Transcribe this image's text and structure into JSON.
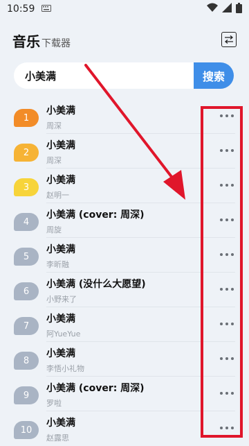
{
  "status": {
    "time": "10:59"
  },
  "header": {
    "title": "音乐",
    "subtitle": "下载器"
  },
  "search": {
    "value": "小美满",
    "button": "搜索"
  },
  "songs": [
    {
      "rank": "1",
      "title": "小美满",
      "artist": "周深",
      "badge_color": "#f28c28"
    },
    {
      "rank": "2",
      "title": "小美满",
      "artist": "周深",
      "badge_color": "#f6b335"
    },
    {
      "rank": "3",
      "title": "小美满",
      "artist": "赵明一",
      "badge_color": "#f7d43a"
    },
    {
      "rank": "4",
      "title": "小美满 (cover: 周深)",
      "artist": "周旋",
      "badge_color": "#a9b4c4"
    },
    {
      "rank": "5",
      "title": "小美满",
      "artist": "李昕融",
      "badge_color": "#a9b4c4"
    },
    {
      "rank": "6",
      "title": "小美满 (没什么大愿望)",
      "artist": "小野来了",
      "badge_color": "#a9b4c4"
    },
    {
      "rank": "7",
      "title": "小美满",
      "artist": "阿YueYue",
      "badge_color": "#a9b4c4"
    },
    {
      "rank": "8",
      "title": "小美满",
      "artist": "李悟小礼物",
      "badge_color": "#a9b4c4"
    },
    {
      "rank": "9",
      "title": "小美满 (cover: 周深)",
      "artist": "罗啦",
      "badge_color": "#a9b4c4"
    },
    {
      "rank": "10",
      "title": "小美满",
      "artist": "赵露思",
      "badge_color": "#a9b4c4"
    }
  ],
  "colors": {
    "accent": "#3f8ee8",
    "annotation": "#e0162b",
    "background": "#eef2f7"
  },
  "icons": {
    "sort": "sort-icon",
    "more": "more-icon",
    "wifi": "wifi-icon",
    "signal": "signal-icon",
    "battery": "battery-icon",
    "keyboard": "keyboard-icon"
  }
}
